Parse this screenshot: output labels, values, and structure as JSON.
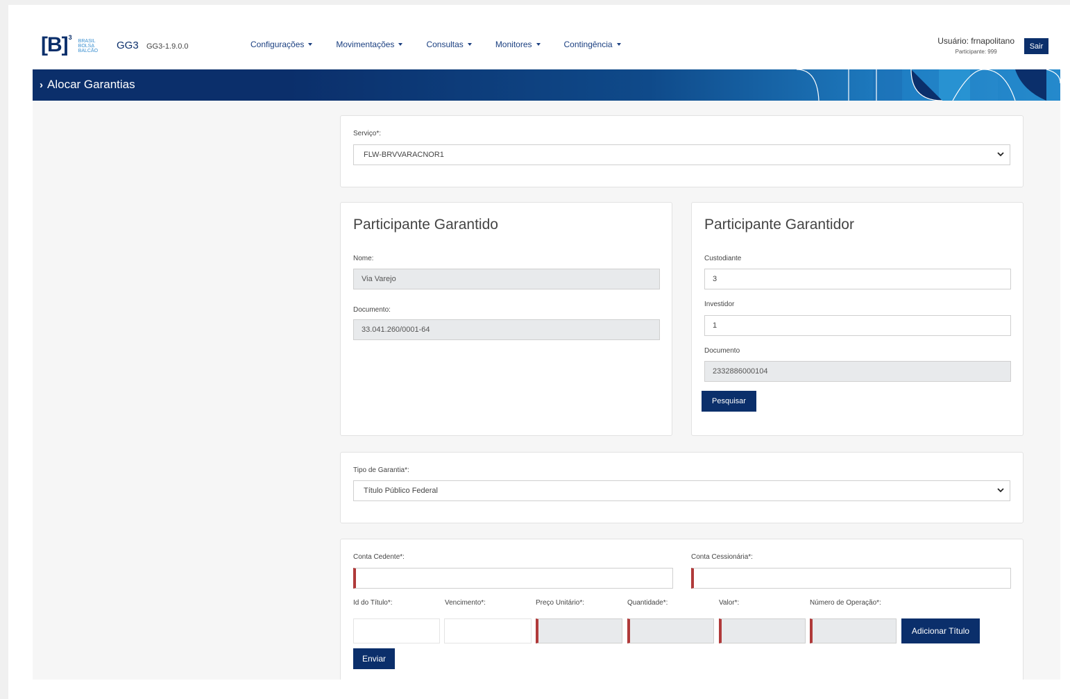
{
  "header": {
    "logo": {
      "mark": "[B]",
      "sup": "3",
      "line1": "BRASIL",
      "line2": "BOLSA",
      "line3": "BALCÃO"
    },
    "app_name": "GG3",
    "app_version": "GG3-1.9.0.0",
    "nav": [
      {
        "label": "Configurações"
      },
      {
        "label": "Movimentações"
      },
      {
        "label": "Consultas"
      },
      {
        "label": "Monitores"
      },
      {
        "label": "Contingência"
      }
    ],
    "user_label": "Usuário: frnapolitano",
    "participant_label": "Participante: 999",
    "logout_label": "Sair"
  },
  "banner": {
    "title": "Alocar Garantias"
  },
  "servico": {
    "label": "Serviço*:",
    "value": "FLW-BRVVARACNOR1"
  },
  "garantido": {
    "title": "Participante Garantido",
    "nome_label": "Nome:",
    "nome_value": "Via Varejo",
    "documento_label": "Documento:",
    "documento_value": "33.041.260/0001-64"
  },
  "garantidor": {
    "title": "Participante Garantidor",
    "custodiante_label": "Custodiante",
    "custodiante_value": "3",
    "investidor_label": "Investidor",
    "investidor_value": "1",
    "documento_label": "Documento",
    "documento_value": "2332886000104",
    "search_label": "Pesquisar"
  },
  "tipo_garantia": {
    "label": "Tipo de Garantia*:",
    "value": "Título Público Federal"
  },
  "alocacao": {
    "conta_cedente_label": "Conta Cedente*:",
    "conta_cessionaria_label": "Conta Cessionária*:",
    "id_titulo_label": "Id do Título*:",
    "vencimento_label": "Vencimento*:",
    "preco_label": "Preço Unitário*:",
    "quantidade_label": "Quantidade*:",
    "valor_label": "Valor*:",
    "numero_operacao_label": "Número de Operação*:",
    "add_button_label": "Adicionar Título",
    "submit_label": "Enviar"
  }
}
